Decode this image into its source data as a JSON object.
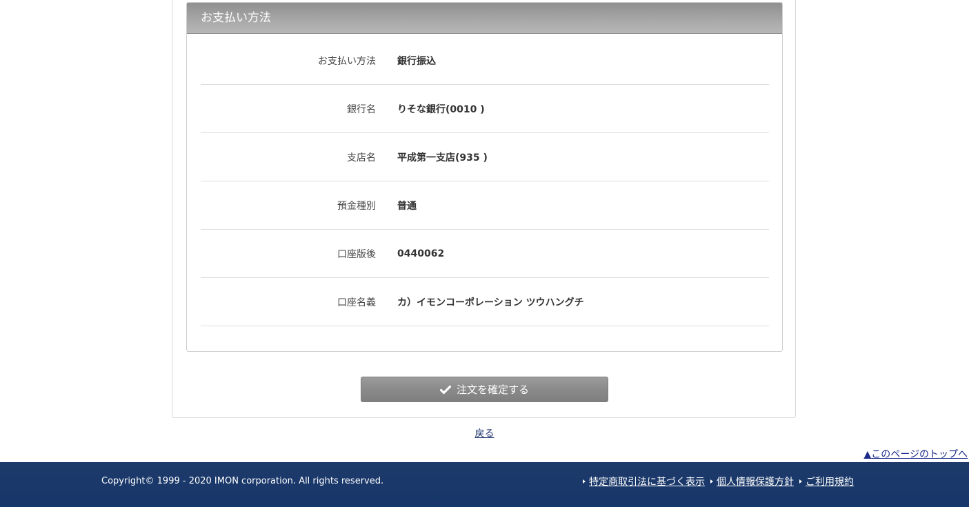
{
  "payment_panel": {
    "title": "お支払い方法",
    "rows": [
      {
        "label": "お支払い方法",
        "value": "銀行振込"
      },
      {
        "label": "銀行名",
        "value": "りそな銀行(0010 )"
      },
      {
        "label": "支店名",
        "value": "平成第一支店(935 )"
      },
      {
        "label": "預金種別",
        "value": "普通"
      },
      {
        "label": "口座版後",
        "value": "0440062"
      },
      {
        "label": "口座名義",
        "value": "カ）イモンコーポレーション ツウハングチ"
      }
    ]
  },
  "confirm_button": {
    "label": "注文を確定する",
    "icon": "check-icon"
  },
  "back_link": {
    "label": "戻る"
  },
  "page_top_link": {
    "label": "▲このページのトップへ"
  },
  "footer": {
    "copyright": "Copyright© 1999 - 2020 IMON corporation. All rights reserved.",
    "links": [
      {
        "label": "特定商取引法に基づく表示"
      },
      {
        "label": "個人情報保護方針"
      },
      {
        "label": "ご利用規約"
      }
    ],
    "background_color": "#173669"
  }
}
